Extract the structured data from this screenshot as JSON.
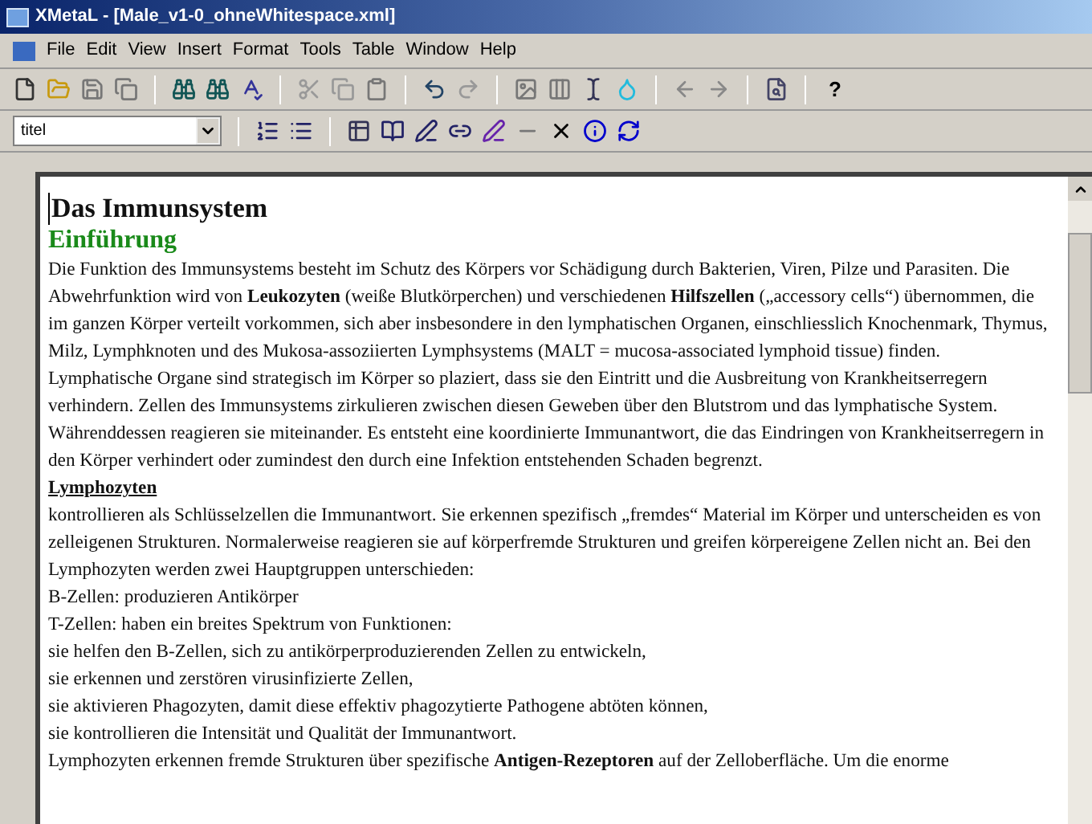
{
  "window": {
    "title": "XMetaL - [Male_v1-0_ohneWhitespace.xml]"
  },
  "menu": [
    "File",
    "Edit",
    "View",
    "Insert",
    "Format",
    "Tools",
    "Table",
    "Window",
    "Help"
  ],
  "toolbar": {
    "help_glyph": "?"
  },
  "style_field": {
    "value": "titel"
  },
  "document": [
    {
      "kind": "title",
      "text": "Das Immunsystem"
    },
    {
      "kind": "heading",
      "text": "Einführung"
    },
    {
      "kind": "paragraph",
      "text": "Die Funktion des Immunsystems besteht im Schutz des Körpers vor Schädigung durch Bakterien, Viren, Pilze und Parasiten. Die Abwehrfunktion wird von **Leukozyten** (weiße Blutkörperchen) und verschiedenen **Hilfszellen** („accessory cells“) übernommen, die im ganzen Körper verteilt vorkommen, sich aber insbesondere in den lymphatischen Organen, einschliesslich Knochenmark, Thymus, Milz, Lymphknoten und des Mukosa-assoziierten Lymphsystems (MALT = mucosa-associated lymphoid tissue) finden."
    },
    {
      "kind": "paragraph",
      "text": "Lymphatische Organe sind strategisch im Körper so plaziert, dass sie den Eintritt und die Ausbreitung von Krankheitserregern verhindern. Zellen des Immunsystems zirkulieren zwischen diesen Geweben über den Blutstrom und das lymphatische System. Währenddessen reagieren sie miteinander. Es entsteht eine koordinierte Immunantwort, die das Eindringen von Krankheitserregern in den Körper verhindert oder zumindest den durch eine Infektion entstehenden Schaden begrenzt."
    },
    {
      "kind": "subheading",
      "text": "Lymphozyten"
    },
    {
      "kind": "paragraph",
      "text": "kontrollieren als Schlüsselzellen die Immunantwort. Sie erkennen spezifisch „fremdes“ Material im Körper und unterscheiden es von zelleigenen Strukturen. Normalerweise reagieren sie auf körperfremde Strukturen und greifen körpereigene Zellen nicht an. Bei den Lymphozyten werden zwei Hauptgruppen unterschieden:"
    },
    {
      "kind": "paragraph",
      "text": "B-Zellen: produzieren Antikörper"
    },
    {
      "kind": "paragraph",
      "text": "T-Zellen: haben ein breites Spektrum von Funktionen:"
    },
    {
      "kind": "paragraph",
      "text": "sie helfen den B-Zellen, sich zu antikörperproduzierenden Zellen zu entwickeln,"
    },
    {
      "kind": "paragraph",
      "text": "sie erkennen und zerstören virusinfizierte Zellen,"
    },
    {
      "kind": "paragraph",
      "text": "sie aktivieren Phagozyten, damit diese effektiv phagozytierte Pathogene abtöten können,"
    },
    {
      "kind": "paragraph",
      "text": "sie kontrollieren die Intensität und Qualität der Immunantwort."
    },
    {
      "kind": "paragraph",
      "text": "Lymphozyten erkennen fremde Strukturen über spezifische **Antigen-Rezeptoren** auf der Zelloberfläche. Um die enorme"
    }
  ]
}
